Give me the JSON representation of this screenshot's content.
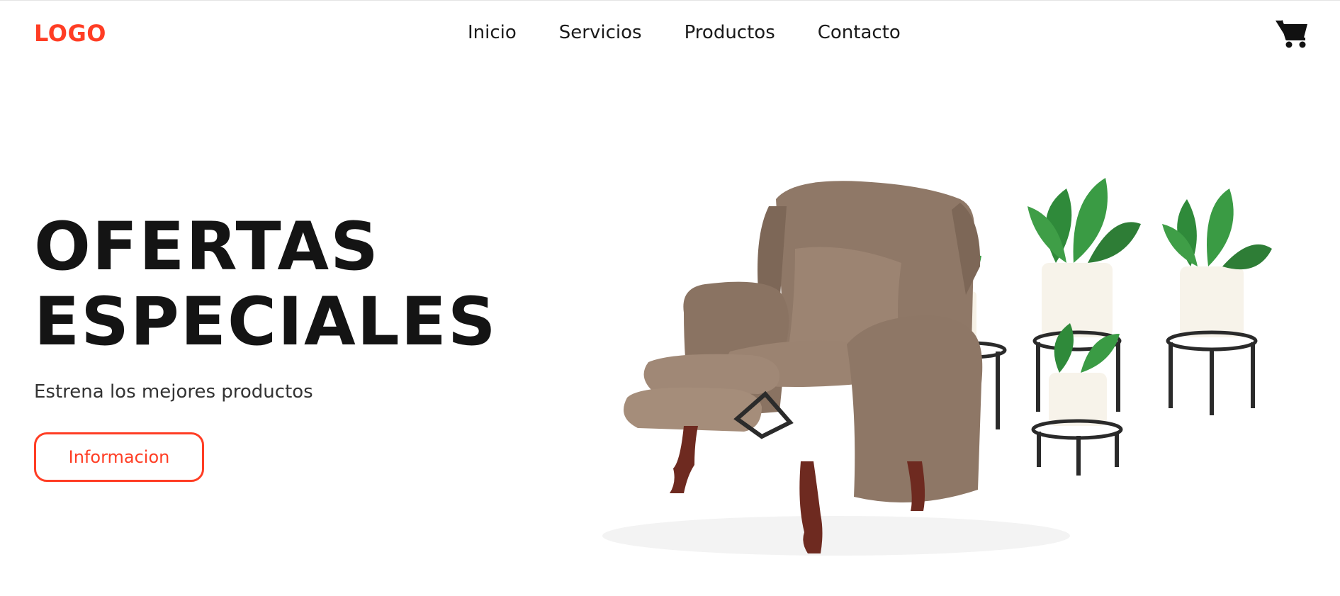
{
  "header": {
    "logo": "LOGO",
    "nav": [
      {
        "label": "Inicio"
      },
      {
        "label": "Servicios"
      },
      {
        "label": "Productos"
      },
      {
        "label": "Contacto"
      }
    ],
    "cart_icon": "shopping-cart-icon"
  },
  "hero": {
    "title_line1": "OFERTAS",
    "title_line2": "ESPECIALES",
    "subtitle": "Estrena los mejores productos",
    "button_label": "Informacion",
    "image": "armchair-and-plant-stands"
  },
  "colors": {
    "accent": "#ff3d24",
    "text": "#141414",
    "muted_text": "#333333",
    "chair": "#8d7563",
    "leaf": "#2f8a3a"
  }
}
